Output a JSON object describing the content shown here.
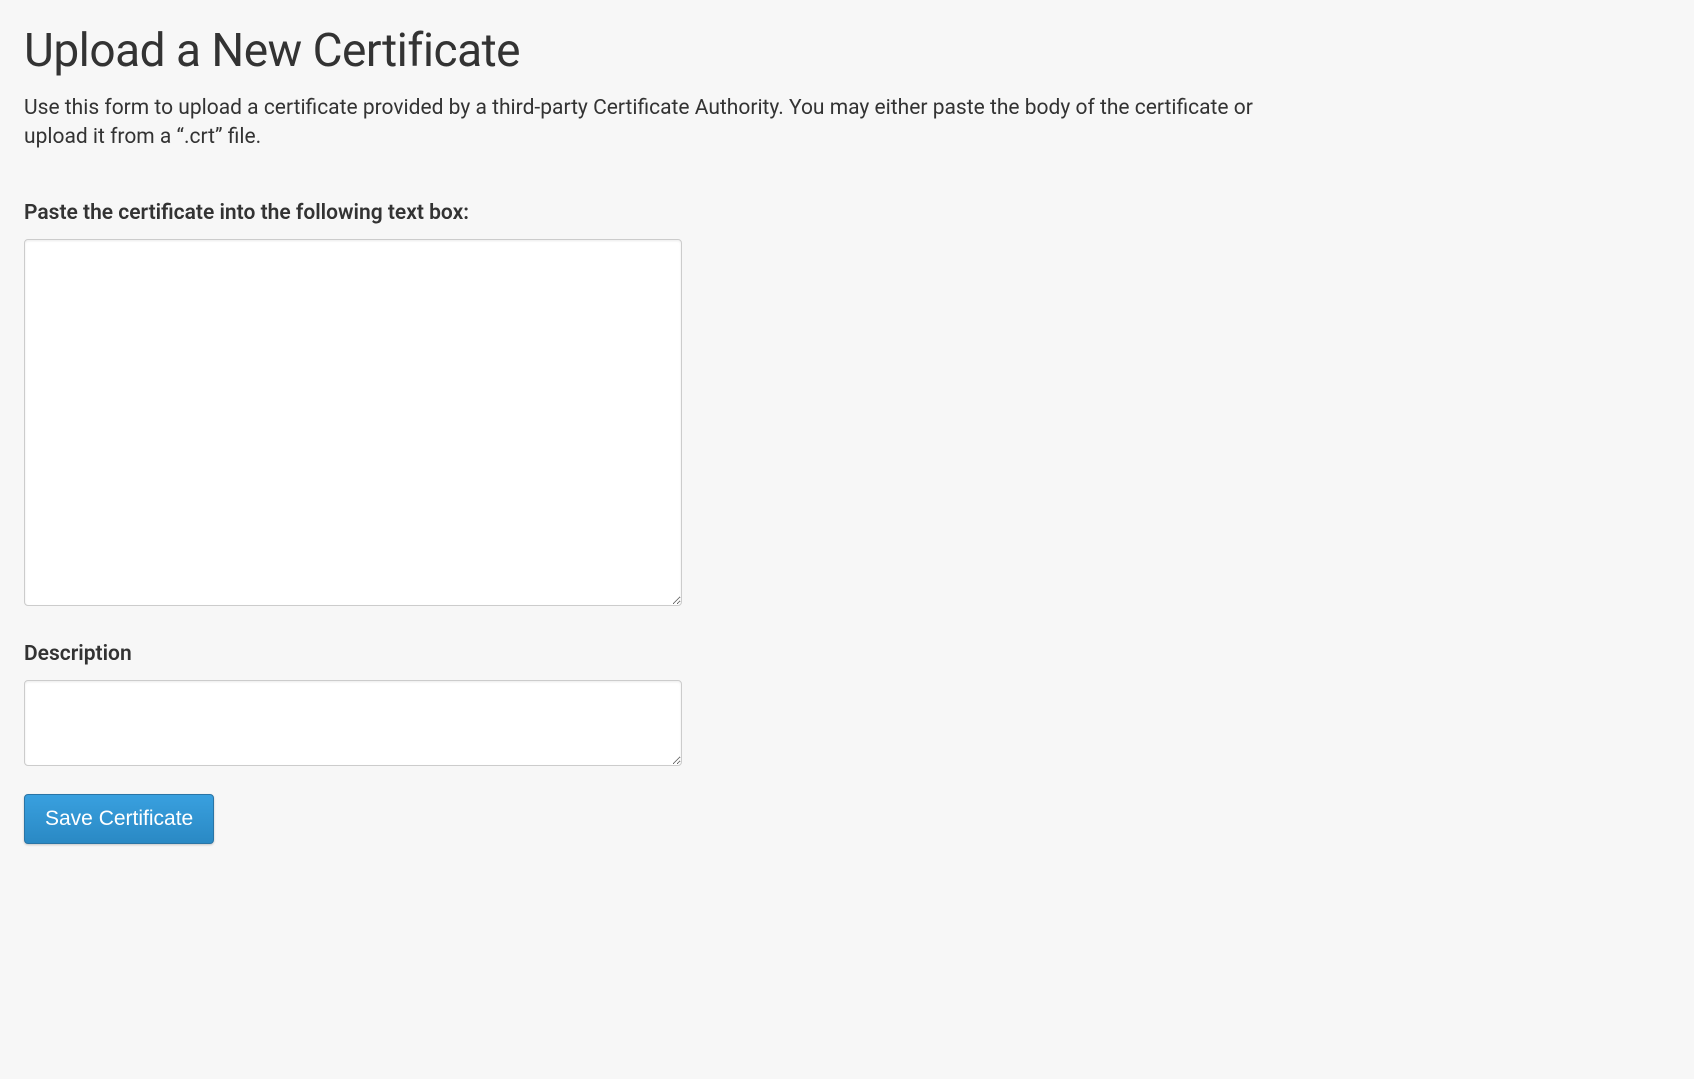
{
  "page": {
    "title": "Upload a New Certificate",
    "intro": "Use this form to upload a certificate provided by a third-party Certificate Authority. You may either paste the body of the certificate or upload it from a “.crt” file."
  },
  "form": {
    "certificate": {
      "label": "Paste the certificate into the following text box:",
      "value": ""
    },
    "description": {
      "label": "Description",
      "value": ""
    },
    "submit_label": "Save Certificate"
  }
}
